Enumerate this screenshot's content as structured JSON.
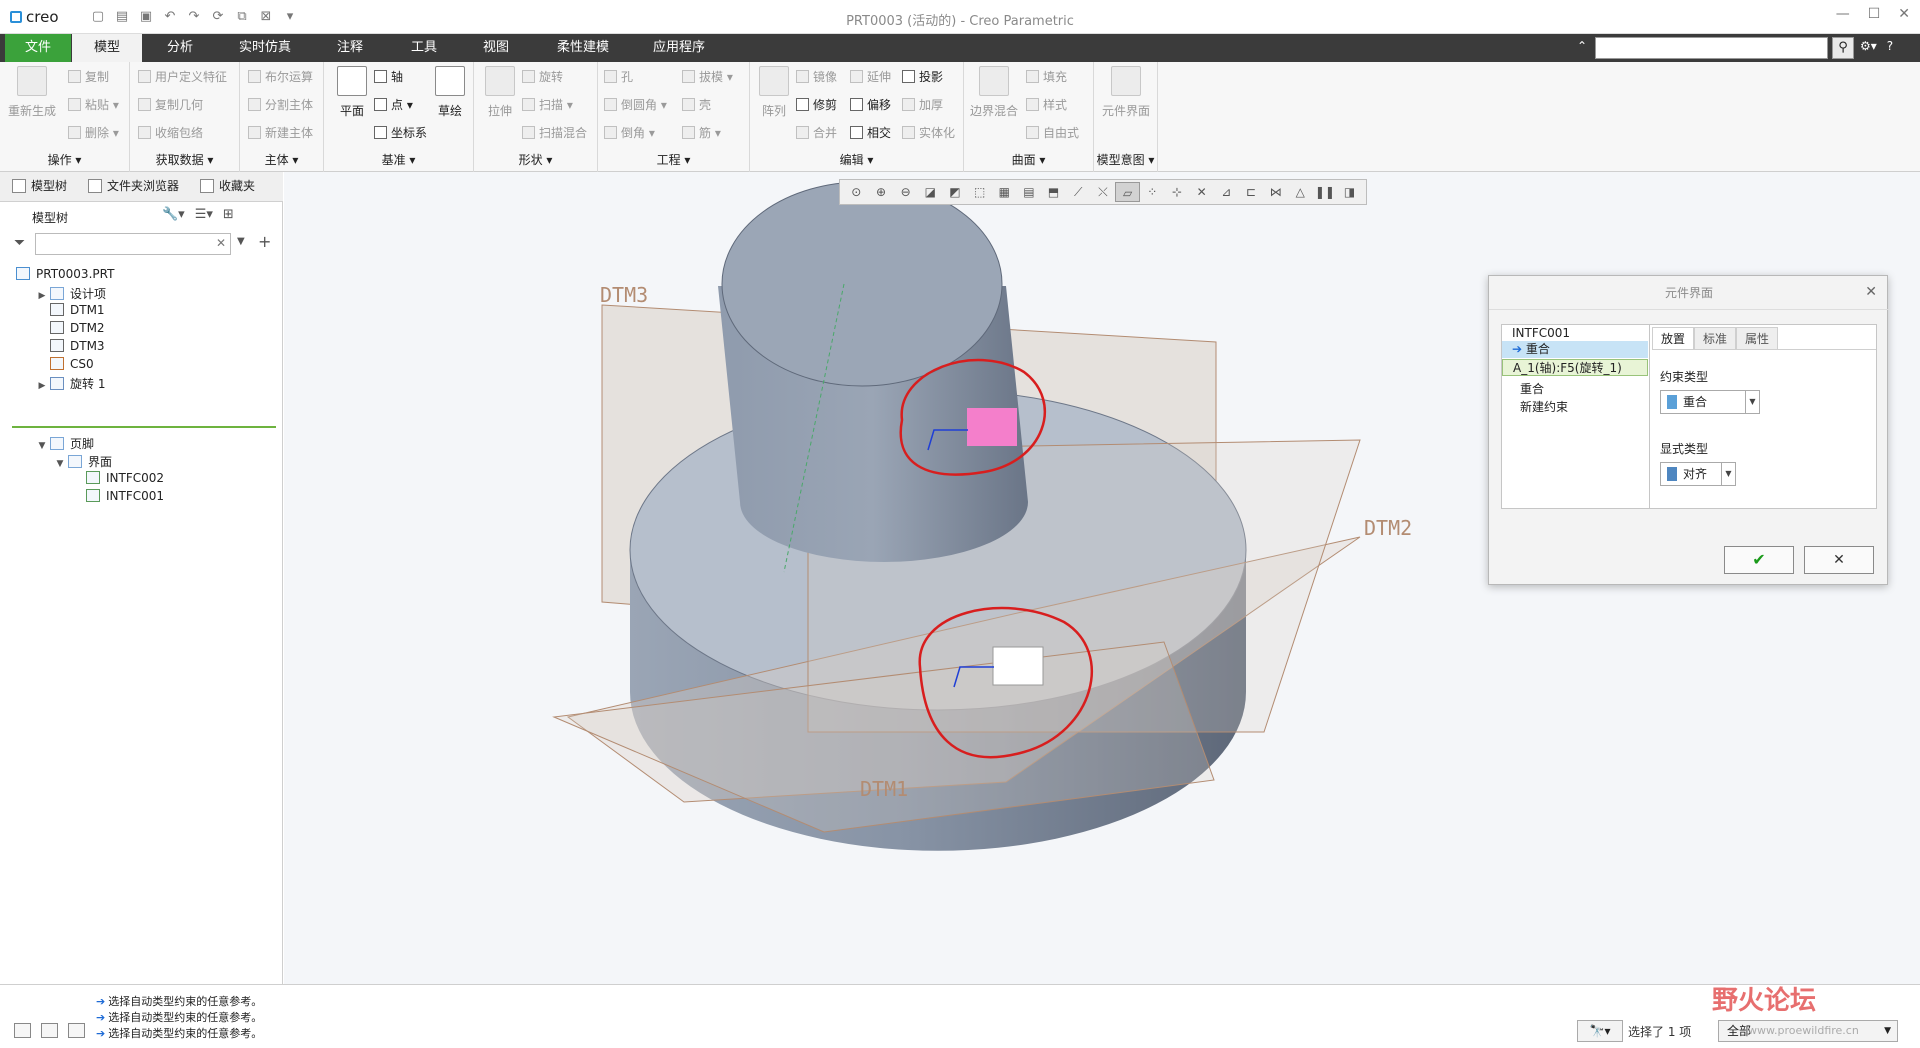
{
  "app": {
    "logo": "creo",
    "window_title": "PRT0003 (活动的) - Creo Parametric"
  },
  "ribbon_tabs": [
    "文件",
    "模型",
    "分析",
    "实时仿真",
    "注释",
    "工具",
    "视图",
    "柔性建模",
    "应用程序"
  ],
  "ribbon": {
    "operations": {
      "title": "操作",
      "regenerate": "重新生成",
      "copy": "复制",
      "paste": "粘贴",
      "delete": "删除"
    },
    "get_data": {
      "title": "获取数据",
      "udf": "用户定义特征",
      "copy_geom": "复制几何",
      "shrinkwrap": "收缩包络"
    },
    "body": {
      "title": "主体",
      "boolean": "布尔运算",
      "split": "分割主体",
      "new_body": "新建主体"
    },
    "datum": {
      "title": "基准",
      "plane": "平面",
      "axis": "轴",
      "point": "点",
      "csys": "坐标系",
      "sketch": "草绘"
    },
    "shapes": {
      "title": "形状",
      "extrude": "拉伸",
      "revolve": "旋转",
      "sweep": "扫描",
      "swept_blend": "扫描混合"
    },
    "engineering": {
      "title": "工程",
      "hole": "孔",
      "round": "倒圆角",
      "chamfer": "倒角",
      "draft": "拔模",
      "shell": "壳",
      "rib": "筋"
    },
    "editing": {
      "title": "编辑",
      "pattern": "阵列",
      "mirror": "镜像",
      "trim": "修剪",
      "merge": "合并",
      "extend": "延伸",
      "offset": "偏移",
      "intersect": "相交",
      "project": "投影",
      "thicken": "加厚",
      "solidify": "实体化"
    },
    "surfaces": {
      "title": "曲面",
      "boundary_blend": "边界混合",
      "fill": "填充",
      "style": "样式",
      "freestyle": "自由式"
    },
    "model_intent": {
      "title": "模型意图",
      "component_interface": "元件界面"
    }
  },
  "nav_tabs": [
    "模型树",
    "文件夹浏览器",
    "收藏夹"
  ],
  "model_tree": {
    "title": "模型树",
    "items": [
      {
        "label": "PRT0003.PRT",
        "indent": 0,
        "expander": ""
      },
      {
        "label": "设计项",
        "indent": 1,
        "expander": "▶"
      },
      {
        "label": "DTM1",
        "indent": 1,
        "expander": ""
      },
      {
        "label": "DTM2",
        "indent": 1,
        "expander": ""
      },
      {
        "label": "DTM3",
        "indent": 1,
        "expander": ""
      },
      {
        "label": "CS0",
        "indent": 1,
        "expander": ""
      },
      {
        "label": "旋转 1",
        "indent": 1,
        "expander": "▶"
      }
    ],
    "footer_items": [
      {
        "label": "页脚",
        "indent": 1,
        "expander": "▼"
      },
      {
        "label": "界面",
        "indent": 2,
        "expander": "▼"
      },
      {
        "label": "INTFC002",
        "indent": 3,
        "expander": ""
      },
      {
        "label": "INTFC001",
        "indent": 3,
        "expander": ""
      }
    ]
  },
  "graphics": {
    "datum_labels": [
      "DTM3",
      "DTM2",
      "DTM1"
    ]
  },
  "dialog": {
    "title": "元件界面",
    "constraint_list": {
      "header": "INTFC001",
      "selected": "重合",
      "reference": "A_1(轴):F5(旋转_1)",
      "item2": "重合",
      "new": "新建约束"
    },
    "tabs": [
      "放置",
      "标准",
      "属性"
    ],
    "constraint_type_label": "约束类型",
    "constraint_type_value": "重合",
    "display_type_label": "显式类型",
    "display_type_value": "对齐",
    "ok": "✔",
    "cancel": "✕"
  },
  "status": {
    "messages": [
      "选择自动类型约束的任意参考。",
      "选择自动类型约束的任意参考。",
      "选择自动类型约束的任意参考。"
    ],
    "selection_count": "选择了 1 项",
    "filter": "全部"
  },
  "watermark": {
    "text": "野火论坛",
    "url": "www.proewildfire.cn"
  },
  "colors": {
    "accent_file": "#3ba23b",
    "tab_bar": "#3b3b3b",
    "model_solid": "#8d99ab",
    "annotation_red": "#d81e1e",
    "marker_pink": "#f47fcb"
  }
}
